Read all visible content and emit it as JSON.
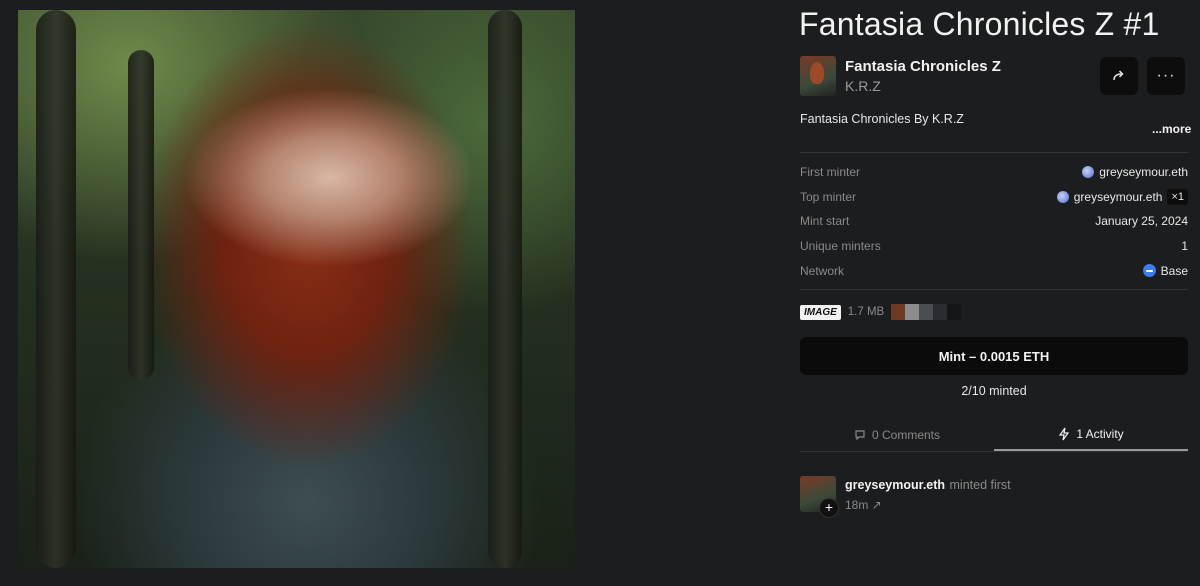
{
  "artwork": {
    "alt_subject": "portrait-artwork"
  },
  "token": {
    "title": "Fantasia Chronicles Z #1"
  },
  "collection": {
    "name": "Fantasia Chronicles Z",
    "creator": "K.R.Z"
  },
  "description": {
    "text": "Fantasia Chronicles By K.R.Z",
    "more_label": "...more"
  },
  "details": {
    "first_minter": {
      "label": "First minter",
      "value": "greyseymour.eth"
    },
    "top_minter": {
      "label": "Top minter",
      "value": "greyseymour.eth",
      "badge": "×1"
    },
    "mint_start": {
      "label": "Mint start",
      "value": "January 25, 2024"
    },
    "unique_minters": {
      "label": "Unique minters",
      "value": "1"
    },
    "network": {
      "label": "Network",
      "value": "Base"
    }
  },
  "media": {
    "type": "IMAGE",
    "size": "1.7 MB",
    "palette": [
      "#6b3a24",
      "#8c8c8c",
      "#4a4d52",
      "#2a2c30",
      "#15161a"
    ]
  },
  "mint": {
    "button_label": "Mint – 0.0015 ETH",
    "progress_text": "2/10 minted"
  },
  "tabs": [
    {
      "label": "0 Comments",
      "icon": "comment-icon"
    },
    {
      "label": "1 Activity",
      "icon": "lightning-icon"
    }
  ],
  "activity": [
    {
      "user": "greyseymour.eth",
      "action": "minted first",
      "time": "18m ↗"
    }
  ],
  "icons": {
    "share": "share-icon",
    "more": "ellipsis-icon"
  }
}
